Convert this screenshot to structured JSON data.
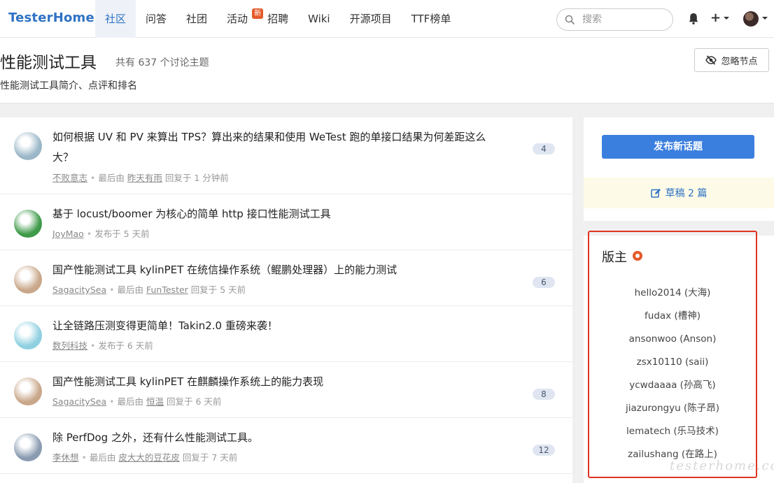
{
  "navbar": {
    "brand": "TesterHome",
    "items": [
      {
        "label": "社区",
        "active": true
      },
      {
        "label": "问答"
      },
      {
        "label": "社团"
      },
      {
        "label": "活动",
        "badge": "新"
      },
      {
        "label": "招聘"
      },
      {
        "label": "Wiki"
      },
      {
        "label": "开源项目"
      },
      {
        "label": "TTF榜单"
      }
    ],
    "search_placeholder": "搜索",
    "plus_label": "+"
  },
  "node": {
    "title": "性能测试工具",
    "count_text": "共有 637 个讨论主题",
    "description": "性能测试工具简介、点评和排名",
    "ignore_label": "忽略节点"
  },
  "topics": [
    {
      "title": "如何根据 UV 和 PV 来算出 TPS？算出来的结果和使用 WeTest 跑的单接口结果为何差距这么大？",
      "author": "不败意志",
      "last_by_label": "最后由",
      "last_user": "昨天有雨",
      "time_text": "回复于 1 分钟前",
      "replies": "4",
      "avatar_color": "#9bb7c8"
    },
    {
      "title": "基于 locust/boomer 为核心的简单 http 接口性能测试工具",
      "author": "JoyMao",
      "time_text": "发布于 5 天前",
      "avatar_color": "#3f9a4a"
    },
    {
      "title": "国产性能测试工具 kylinPET 在统信操作系统（鲲鹏处理器）上的能力测试",
      "author": "SagacitySea",
      "last_by_label": "最后由",
      "last_user": "FunTester",
      "time_text": "回复于 5 天前",
      "replies": "6",
      "avatar_color": "#c9a78a"
    },
    {
      "title": "让全链路压测变得更简单！Takin2.0 重磅来袭！",
      "author": "数列科技",
      "time_text": "发布于 6 天前",
      "avatar_color": "#8fd0e0"
    },
    {
      "title": "国产性能测试工具 kylinPET 在麒麟操作系统上的能力表现",
      "author": "SagacitySea",
      "last_by_label": "最后由",
      "last_user": "恒温",
      "time_text": "回复于 6 天前",
      "replies": "8",
      "avatar_color": "#c9a78a"
    },
    {
      "title": "除 PerfDog 之外，还有什么性能测试工具。",
      "author": "李休想",
      "last_by_label": "最后由",
      "last_user": "皮大大的豆花皮",
      "time_text": "回复于 7 天前",
      "replies": "12",
      "avatar_color": "#8a9bb0"
    }
  ],
  "sidebar": {
    "new_topic_label": "发布新话题",
    "draft_label": "草稿 2 篇"
  },
  "moderators": {
    "title": "版主",
    "items": [
      "hello2014 (大海)",
      "fudax (槽神)",
      "ansonwoo (Anson)",
      "zsx10110 (saii)",
      "ycwdaaaa (孙高飞)",
      "jiazurongyu (陈子昂)",
      "lematech (乐马技术)",
      "zailushang (在路上)"
    ]
  },
  "watermark": "testerhome.com",
  "colors": {
    "brand": "#2f72c4",
    "primary_button": "#3b7fde",
    "highlight_border": "#e0341f",
    "badge": "#e55a2b"
  }
}
